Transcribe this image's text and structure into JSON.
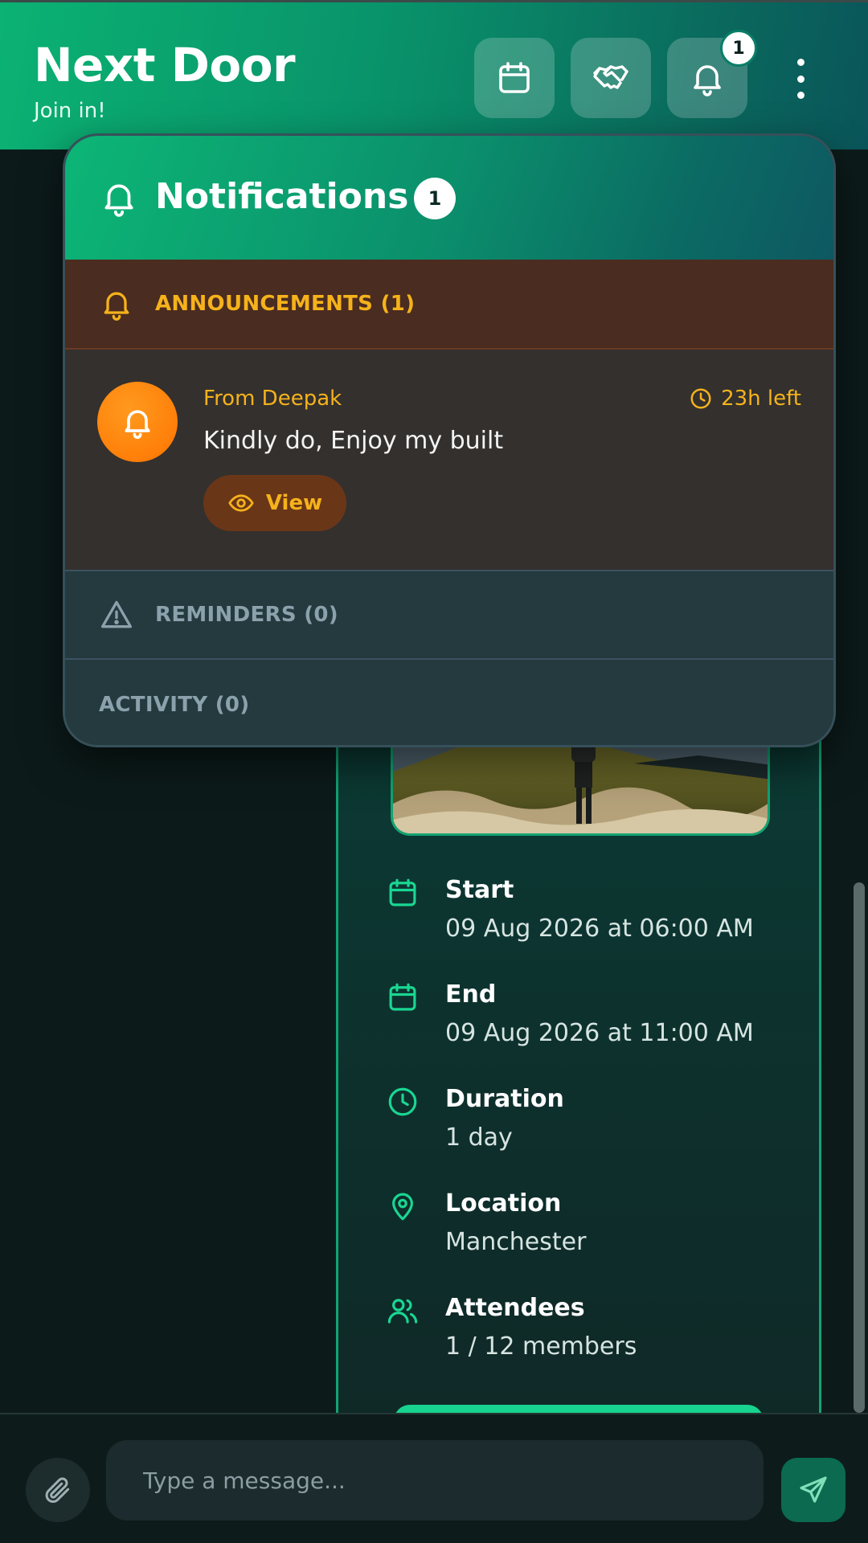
{
  "header": {
    "title": "Next Door",
    "subtitle": "Join in!",
    "buttons": [
      {
        "icon": "calendar-icon"
      },
      {
        "icon": "handshake-icon"
      },
      {
        "icon": "bell-icon",
        "badge": "1"
      }
    ],
    "menu_icon": "more-vertical-icon"
  },
  "notifications": {
    "title": "Notifications",
    "count": "1",
    "announcements": {
      "label": "ANNOUNCEMENTS (1)",
      "items": [
        {
          "from": "From Deepak",
          "time_left": "23h left",
          "message": "Kindly do, Enjoy my built",
          "view_label": "View"
        }
      ]
    },
    "reminders_label": "REMINDERS (0)",
    "activity_label": "ACTIVITY (0)"
  },
  "event": {
    "details": [
      {
        "icon": "calendar-icon",
        "label": "Start",
        "value": "09 Aug 2026 at 06:00 AM"
      },
      {
        "icon": "calendar-icon",
        "label": "End",
        "value": "09 Aug 2026 at 11:00 AM"
      },
      {
        "icon": "clock-icon",
        "label": "Duration",
        "value": "1 day"
      },
      {
        "icon": "map-pin-icon",
        "label": "Location",
        "value": "Manchester"
      },
      {
        "icon": "users-icon",
        "label": "Attendees",
        "value": "1 / 12 members"
      }
    ]
  },
  "composer": {
    "placeholder": "Type a message..."
  },
  "colors": {
    "accent_green": "#0bb273",
    "announcement_amber": "#f5b21b",
    "avatar_orange": "#ff8a0a",
    "background": "#0c1b1a"
  }
}
